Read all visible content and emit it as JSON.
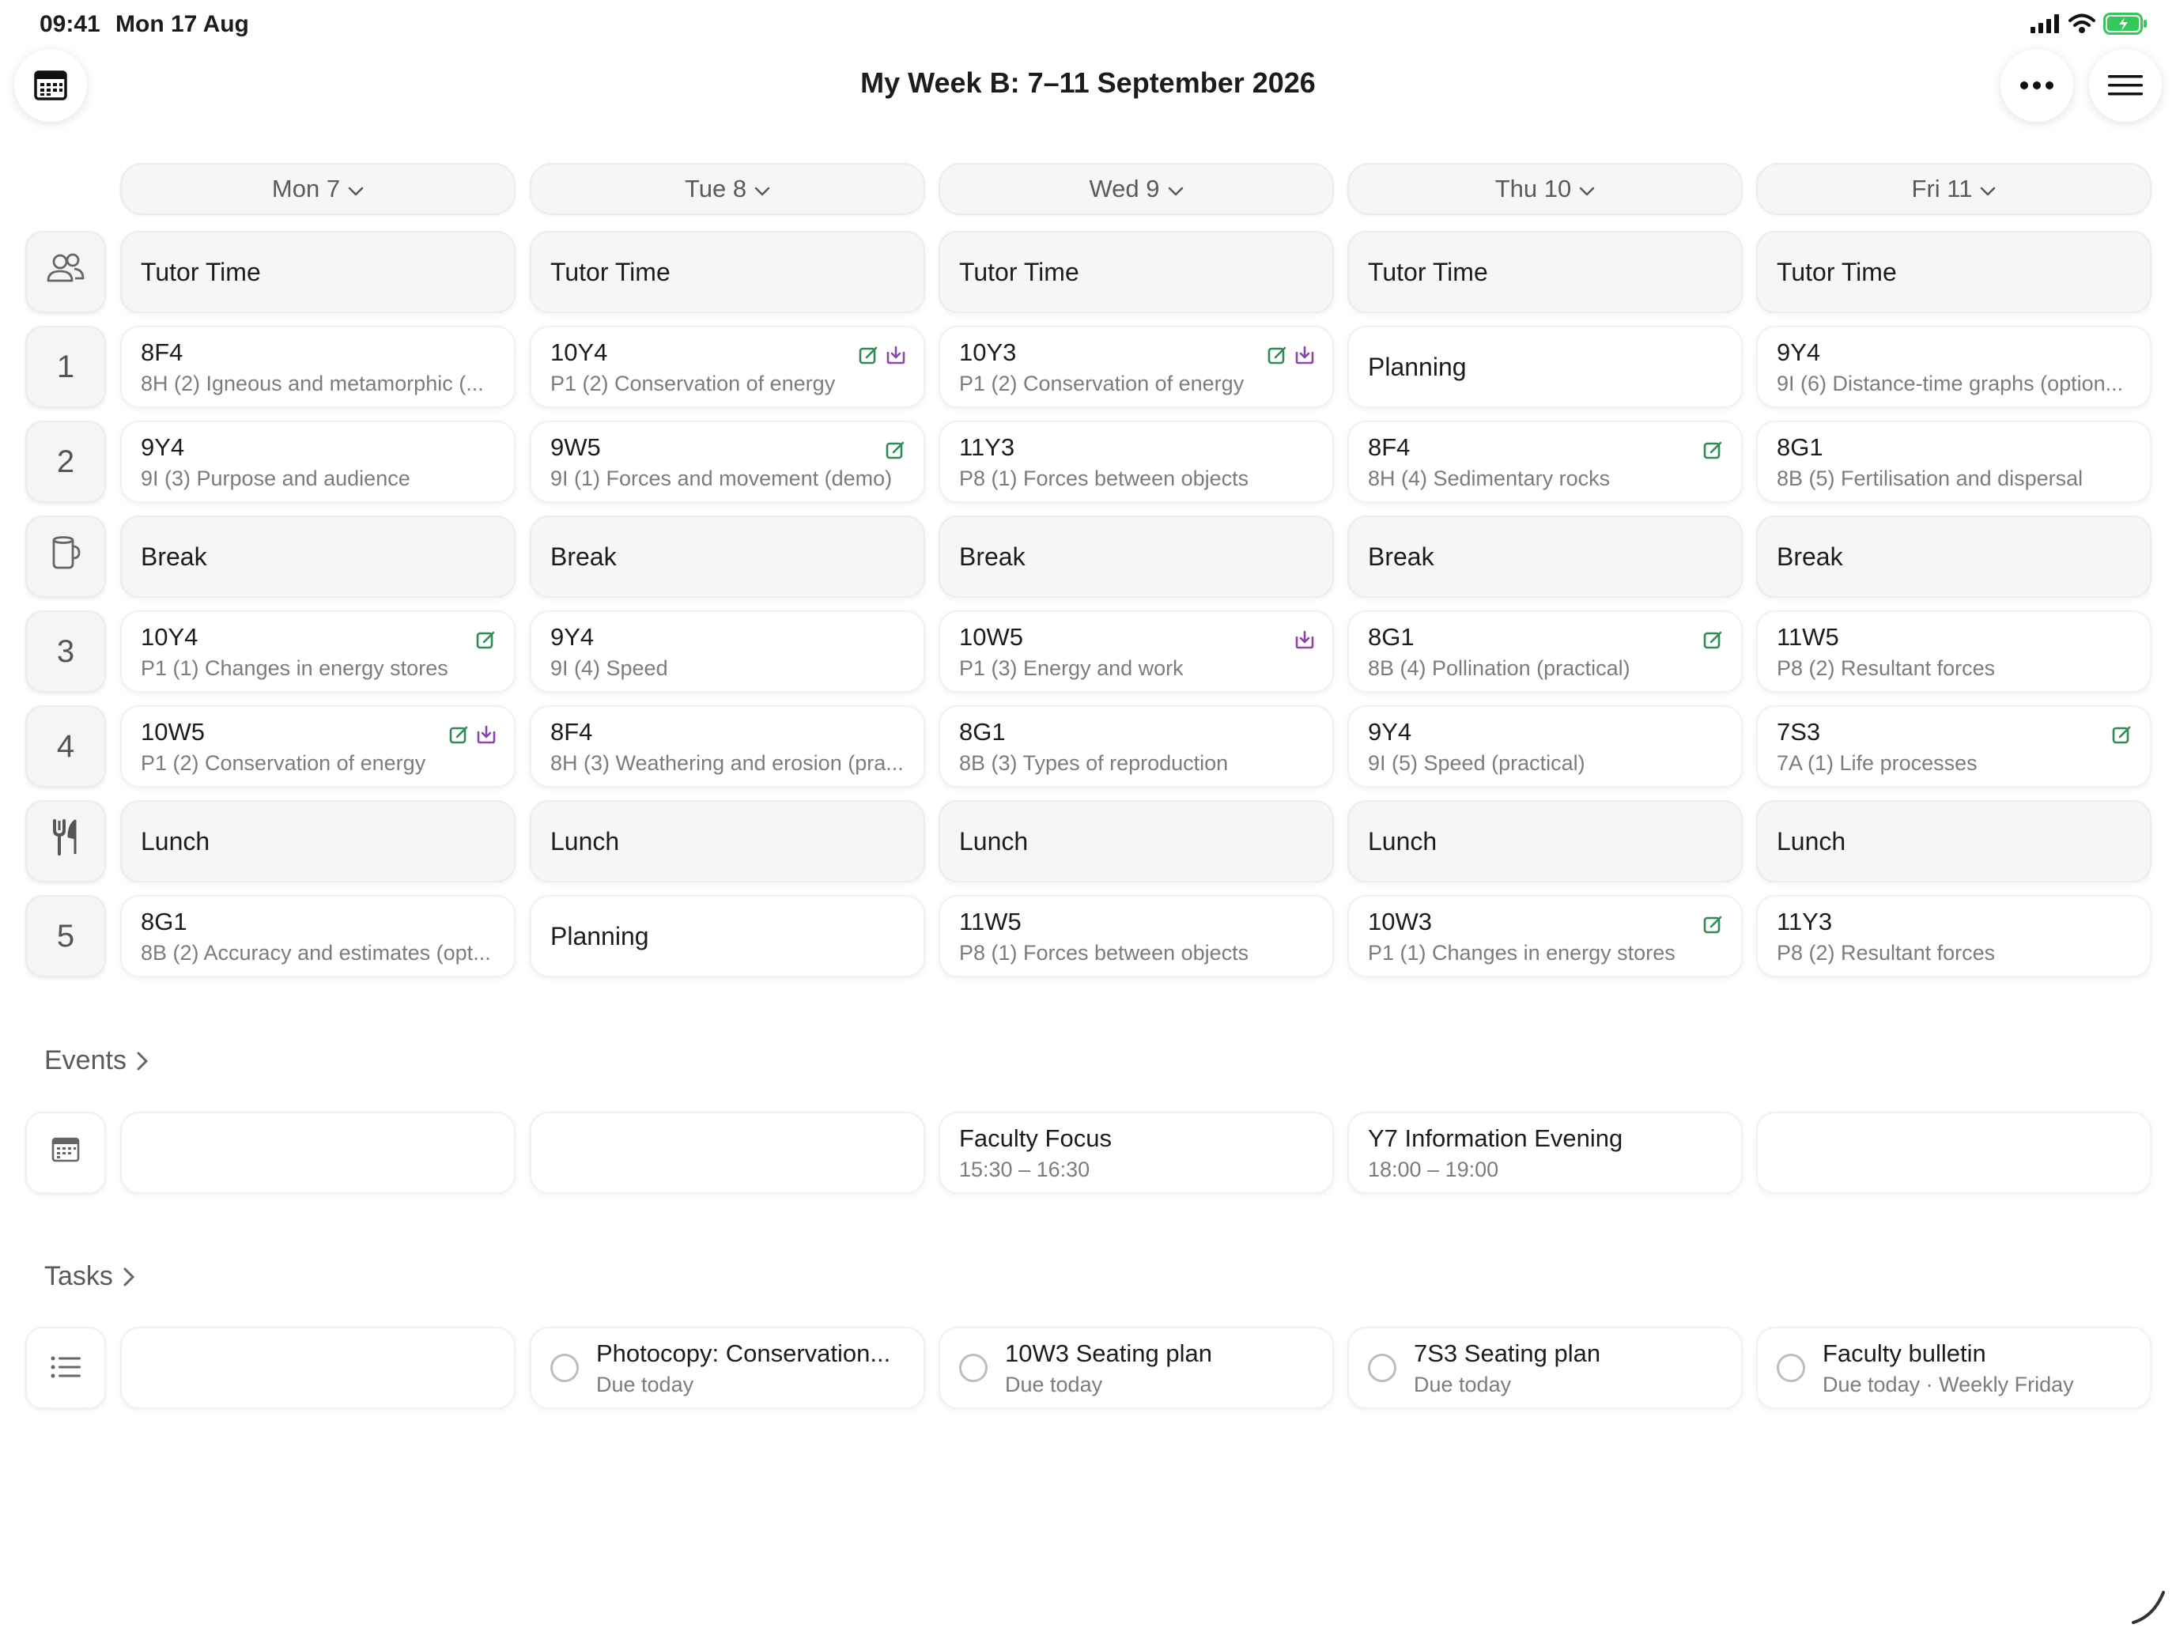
{
  "status_bar": {
    "time": "09:41",
    "date": "Mon 17 Aug"
  },
  "header": {
    "title": "My Week B: 7–11 September 2026"
  },
  "days": [
    "Mon 7",
    "Tue 8",
    "Wed 9",
    "Thu 10",
    "Fri 11"
  ],
  "rows": [
    {
      "label": "",
      "icon": "people-icon",
      "kind": "tutor",
      "cells": [
        {
          "title": "Tutor Time"
        },
        {
          "title": "Tutor Time"
        },
        {
          "title": "Tutor Time"
        },
        {
          "title": "Tutor Time"
        },
        {
          "title": "Tutor Time"
        }
      ]
    },
    {
      "label": "1",
      "kind": "lesson",
      "cells": [
        {
          "title": "8F4",
          "subtitle": "8H (2) Igneous and metamorphic (...",
          "icons": []
        },
        {
          "title": "10Y4",
          "subtitle": "P1 (2) Conservation of energy",
          "icons": [
            "edit",
            "download"
          ]
        },
        {
          "title": "10Y3",
          "subtitle": "P1 (2) Conservation of energy",
          "icons": [
            "edit",
            "download"
          ]
        },
        {
          "title": "Planning"
        },
        {
          "title": "9Y4",
          "subtitle": "9I (6) Distance-time graphs (option...",
          "icons": []
        }
      ]
    },
    {
      "label": "2",
      "kind": "lesson",
      "cells": [
        {
          "title": "9Y4",
          "subtitle": "9I (3) Purpose and audience",
          "icons": []
        },
        {
          "title": "9W5",
          "subtitle": "9I (1) Forces and movement (demo)",
          "icons": [
            "edit"
          ]
        },
        {
          "title": "11Y3",
          "subtitle": "P8 (1) Forces between objects",
          "icons": []
        },
        {
          "title": "8F4",
          "subtitle": "8H (4) Sedimentary rocks",
          "icons": [
            "edit"
          ]
        },
        {
          "title": "8G1",
          "subtitle": "8B (5) Fertilisation and dispersal",
          "icons": []
        }
      ]
    },
    {
      "label": "",
      "icon": "cup-icon",
      "kind": "break",
      "cells": [
        {
          "title": "Break"
        },
        {
          "title": "Break"
        },
        {
          "title": "Break"
        },
        {
          "title": "Break"
        },
        {
          "title": "Break"
        }
      ]
    },
    {
      "label": "3",
      "kind": "lesson",
      "cells": [
        {
          "title": "10Y4",
          "subtitle": "P1 (1) Changes in energy stores",
          "icons": [
            "edit"
          ]
        },
        {
          "title": "9Y4",
          "subtitle": "9I (4) Speed",
          "icons": []
        },
        {
          "title": "10W5",
          "subtitle": "P1 (3) Energy and work",
          "icons": [
            "download"
          ]
        },
        {
          "title": "8G1",
          "subtitle": "8B (4) Pollination (practical)",
          "icons": [
            "edit"
          ]
        },
        {
          "title": "11W5",
          "subtitle": "P8 (2) Resultant forces",
          "icons": []
        }
      ]
    },
    {
      "label": "4",
      "kind": "lesson",
      "cells": [
        {
          "title": "10W5",
          "subtitle": "P1 (2) Conservation of energy",
          "icons": [
            "edit",
            "download"
          ]
        },
        {
          "title": "8F4",
          "subtitle": "8H (3) Weathering and erosion (pra...",
          "icons": []
        },
        {
          "title": "8G1",
          "subtitle": "8B (3) Types of reproduction",
          "icons": []
        },
        {
          "title": "9Y4",
          "subtitle": "9I (5) Speed (practical)",
          "icons": []
        },
        {
          "title": "7S3",
          "subtitle": "7A (1) Life processes",
          "icons": [
            "edit"
          ]
        }
      ]
    },
    {
      "label": "",
      "icon": "fork-knife-icon",
      "kind": "lunch",
      "cells": [
        {
          "title": "Lunch"
        },
        {
          "title": "Lunch"
        },
        {
          "title": "Lunch"
        },
        {
          "title": "Lunch"
        },
        {
          "title": "Lunch"
        }
      ]
    },
    {
      "label": "5",
      "kind": "lesson",
      "cells": [
        {
          "title": "8G1",
          "subtitle": "8B (2) Accuracy and estimates (opt...",
          "icons": []
        },
        {
          "title": "Planning"
        },
        {
          "title": "11W5",
          "subtitle": "P8 (1) Forces between objects",
          "icons": []
        },
        {
          "title": "10W3",
          "subtitle": "P1 (1) Changes in energy stores",
          "icons": [
            "edit"
          ]
        },
        {
          "title": "11Y3",
          "subtitle": "P8 (2) Resultant forces",
          "icons": []
        }
      ]
    }
  ],
  "events": {
    "header": "Events",
    "cells": [
      {},
      {},
      {
        "title": "Faculty Focus",
        "subtitle": "15:30 – 16:30"
      },
      {
        "title": "Y7 Information Evening",
        "subtitle": "18:00 – 19:00"
      },
      {}
    ]
  },
  "tasks": {
    "header": "Tasks",
    "cells": [
      {},
      {
        "title": "Photocopy: Conservation...",
        "subtitle": "Due today"
      },
      {
        "title": "10W3 Seating plan",
        "subtitle": "Due today"
      },
      {
        "title": "7S3 Seating plan",
        "subtitle": "Due today"
      },
      {
        "title": "Faculty bulletin",
        "subtitle": "Due today · Weekly Friday"
      }
    ]
  },
  "colors": {
    "edit_icon": "#2e8b57",
    "download_icon": "#8e44ad",
    "battery": "#34c759"
  }
}
